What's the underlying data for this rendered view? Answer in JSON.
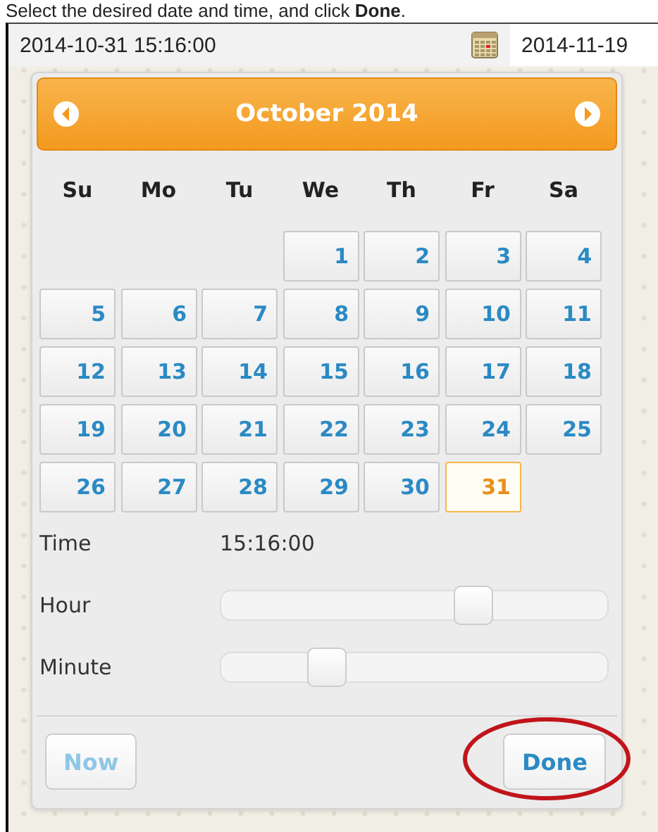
{
  "instruction": "Select the desired date and time, and click **Done**.",
  "fields": [
    {
      "value": "2014-10-31 15:16:00",
      "kind": "datetime"
    },
    {
      "value": "2014-11-19",
      "kind": "plain"
    }
  ],
  "calendar": {
    "month_label": "October 2014",
    "weekdays": [
      "Su",
      "Mo",
      "Tu",
      "We",
      "Th",
      "Fr",
      "Sa"
    ],
    "days": [
      {
        "kind": "blank"
      },
      {
        "kind": "blank"
      },
      {
        "kind": "blank"
      },
      {
        "kind": "day",
        "label": "1",
        "selected": false
      },
      {
        "label": "2",
        "selected": false
      },
      {
        "label": "3",
        "selected": false
      },
      {
        "label": "4",
        "selected": false
      },
      {
        "label": "5",
        "selected": false
      },
      {
        "label": "6",
        "selected": false
      },
      {
        "label": "7",
        "selected": false
      },
      {
        "label": "8",
        "selected": false
      },
      {
        "label": "9",
        "selected": false
      },
      {
        "label": "10",
        "selected": false
      },
      {
        "label": "11",
        "selected": false
      },
      {
        "label": "12",
        "selected": false
      },
      {
        "label": "13",
        "selected": false
      },
      {
        "label": "14",
        "selected": false
      },
      {
        "label": "15",
        "selected": false
      },
      {
        "label": "16",
        "selected": false
      },
      {
        "label": "17",
        "selected": false
      },
      {
        "label": "18",
        "selected": false
      },
      {
        "label": "19",
        "selected": false
      },
      {
        "label": "20",
        "selected": false
      },
      {
        "label": "21",
        "selected": false
      },
      {
        "label": "22",
        "selected": false
      },
      {
        "label": "23",
        "selected": false
      },
      {
        "label": "24",
        "selected": false
      },
      {
        "label": "25",
        "selected": false
      },
      {
        "label": "26",
        "selected": false
      },
      {
        "label": "27",
        "selected": false
      },
      {
        "label": "28",
        "selected": false
      },
      {
        "label": "29",
        "selected": false
      },
      {
        "label": "30",
        "selected": false
      },
      {
        "label": "31",
        "selected": true
      }
    ]
  },
  "time": {
    "label": "Time",
    "value": "15:16:00"
  },
  "sliders": [
    {
      "label": "Hour",
      "level": 0.65
    },
    {
      "label": "Minute",
      "level": 0.27
    }
  ],
  "buttons": [
    {
      "label": "Now",
      "highlighted": false
    },
    {
      "label": "Done",
      "highlighted": true
    }
  ]
}
